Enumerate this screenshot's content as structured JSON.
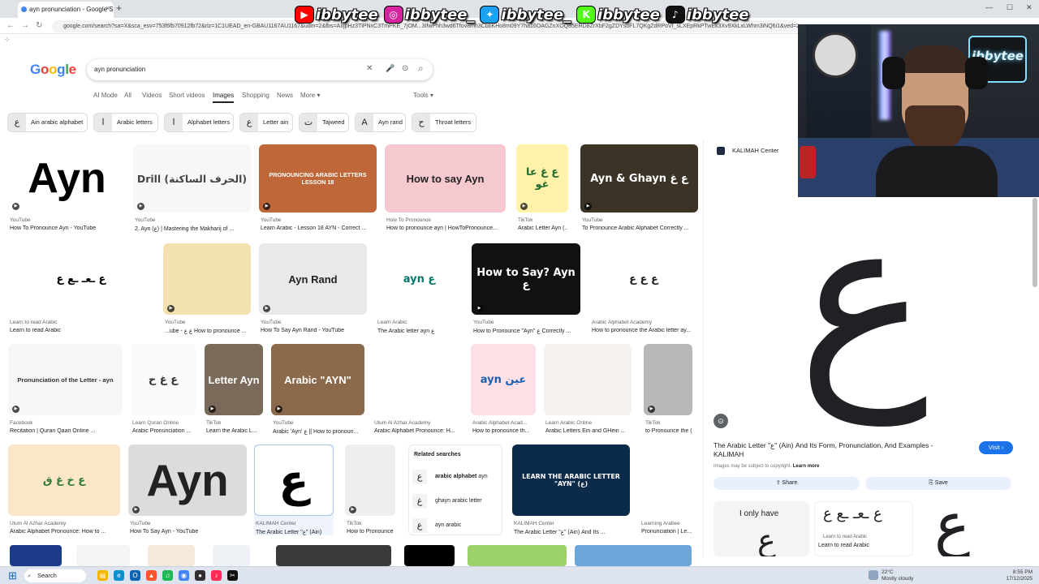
{
  "browser": {
    "tab_title": "ayn pronunciation - Google Search",
    "url": "google.com/search?sa=X&sca_esv=753f6fb70912fb72&rlz=1C1UEAD_en-GBAU1167AU1167&udm=2&fbs=AIIjpHz3TlPNxC3TmPKE_7jOM...3IfwPhh3wd6Tfov8mn3CbbKHo8m09Y7ha16OAGZnXOQ85ERD8ZrXbF2gZDYsoFL7QKgZdRPoVf_sLXEpRkPTwEk3Xv9XkLxLWhm3iNQ6i1&ved=2ahUKEwi",
    "close_glyph": "×",
    "new_tab_glyph": "+",
    "back_glyph": "←",
    "forward_glyph": "→",
    "reload_glyph": "↻",
    "apps_glyph": "⁘",
    "minimize_glyph": "—",
    "maximize_glyph": "☐",
    "window_close_glyph": "✕"
  },
  "social_overlay": [
    {
      "icon": "youtube-icon",
      "glyph": "▶",
      "color": "#ff0000",
      "handle": "ibbytee"
    },
    {
      "icon": "instagram-icon",
      "glyph": "◎",
      "color": "#d6249f",
      "handle": "ibbytee_"
    },
    {
      "icon": "twitter-icon",
      "glyph": "✦",
      "color": "#1da1f2",
      "handle": "ibbytee_"
    },
    {
      "icon": "kick-icon",
      "glyph": "K",
      "color": "#53fc18",
      "handle": "ibbytee"
    },
    {
      "icon": "tiktok-icon",
      "glyph": "♪",
      "color": "#111111",
      "handle": "ibbytee"
    }
  ],
  "google": {
    "logo": "Google",
    "logo_colors": [
      "#4285f4",
      "#ea4335",
      "#fbbc05",
      "#4285f4",
      "#34a853",
      "#ea4335"
    ],
    "query": "ayn pronunciation",
    "clear_glyph": "✕",
    "mic_glyph": "🎤",
    "lens_glyph": "⊙",
    "search_glyph": "⌕",
    "tabs": [
      "AI Mode",
      "All",
      "Videos",
      "Short videos",
      "Images",
      "Shopping",
      "News",
      "More ▾",
      "Tools ▾"
    ],
    "active_tab": "Images"
  },
  "chips": [
    {
      "label": "Ain arabic alphabet",
      "thumb": "ع"
    },
    {
      "label": "Arabic letters",
      "thumb": "ا"
    },
    {
      "label": "Alphabet letters",
      "thumb": "ا"
    },
    {
      "label": "Letter ain",
      "thumb": "ع"
    },
    {
      "label": "Tajweed",
      "thumb": "ت"
    },
    {
      "label": "Ayn rand",
      "thumb": "A"
    },
    {
      "label": "Throat letters",
      "thumb": "ح"
    }
  ],
  "results": [
    {
      "source": "YouTube",
      "title": "How To Pronounce Ayn - YouTube",
      "img_text": "Ayn",
      "bg": "#ffffff",
      "fg": "#000000"
    },
    {
      "source": "YouTube",
      "title": "2. Ayn (ع) | Mastering the Makharij of ...",
      "img_text": "Drill (الحرف الساكنة)",
      "bg": "#f7f7f7",
      "fg": "#444444"
    },
    {
      "source": "YouTube",
      "title": "Learn Arabic - Lesson 18 AYN - Correct ...",
      "img_text": "PRONOUNCING ARABIC LETTERS LESSON 18",
      "bg": "#c0673a",
      "fg": "#ffffff"
    },
    {
      "source": "How To Pronounce",
      "title": "How to pronounce ayn | HowToPronounce...",
      "img_text": "How to say Ayn",
      "bg": "#f5c9cf",
      "fg": "#222222"
    },
    {
      "source": "TikTok",
      "title": "Arabic Letter Ayn (...",
      "img_text": "ع غ عا غو",
      "bg": "#fff1a8",
      "fg": "#1e6b2f"
    },
    {
      "source": "YouTube",
      "title": "To Pronounce Arabic Alphabet Correctly ...",
      "img_text": "Ayn & Ghayn ع غ",
      "bg": "#3a3326",
      "fg": "#ffffff"
    },
    {
      "source": "Learn to read Arabic",
      "title": "Learn to read Arabic",
      "img_text": "ع ـعـ ـع ع",
      "bg": "#ffffff",
      "fg": "#000000"
    },
    {
      "source": "YouTube",
      "title": "...ube - ع ع How to pronounce ...",
      "img_text": "",
      "bg": "#f3e2b0",
      "fg": "#333333"
    },
    {
      "source": "YouTube",
      "title": "How To Say Ayn Rand - YouTube",
      "img_text": "Ayn Rand",
      "bg": "#e9e9e9",
      "fg": "#222222"
    },
    {
      "source": "Learn Arabic",
      "title": "The Arabic letter ayn ع",
      "img_text": "ayn ع",
      "bg": "#ffffff",
      "fg": "#00796b"
    },
    {
      "source": "YouTube",
      "title": "How to Pronounce \"Ayn\" ع Correctly ...",
      "img_text": "How to Say? Ayn ع",
      "bg": "#111111",
      "fg": "#ffffff"
    },
    {
      "source": "Arabic Alphabet Academy",
      "title": "How to pronounce the Arabic letter ay...",
      "img_text": "ع ع ع",
      "bg": "#ffffff",
      "fg": "#222222"
    },
    {
      "source": "Facebook",
      "title": "Recitation | Quran Qaari Online ...",
      "img_text": "Pronunciation of the Letter - ayn",
      "bg": "#f6f6f6",
      "fg": "#333333"
    },
    {
      "source": "Learn Quran Online",
      "title": "Arabic Pronunciation ...",
      "img_text": "ع غ ح",
      "bg": "#fafafa",
      "fg": "#333333"
    },
    {
      "source": "TikTok",
      "title": "Learn the Arabic L...",
      "img_text": "Letter Ayn",
      "bg": "#7a6a5a",
      "fg": "#ffffff"
    },
    {
      "source": "YouTube",
      "title": "Arabic 'Ayn' ع || How to pronoun...",
      "img_text": "Arabic \"AYN\"",
      "bg": "#8a6a4a",
      "fg": "#ffffff"
    },
    {
      "source": "Ulum Al Azhar Academy",
      "title": "Arabic Alphabet Pronounce: H...",
      "img_text": "",
      "bg": "#ffffff",
      "fg": "#333333"
    },
    {
      "source": "Arabic Alphabet Acad...",
      "title": "How to pronounce th...",
      "img_text": "ayn عين",
      "bg": "#fde0e6",
      "fg": "#1a5fb4"
    },
    {
      "source": "Learn Arabic Online",
      "title": "Arabic Letters Ein and GHein ...",
      "img_text": "",
      "bg": "#f7f2ee",
      "fg": "#333333"
    },
    {
      "source": "TikTok",
      "title": "to Pronounce the (...",
      "img_text": "",
      "bg": "#b8b8b8",
      "fg": "#222222"
    },
    {
      "source": "Ulum Al Azhar Academy",
      "title": "Arabic Alphabet Pronounce: How to ...",
      "img_text": "ع خ غ ق",
      "bg": "#fbe7c7",
      "fg": "#2e7d32"
    },
    {
      "source": "YouTube",
      "title": "How To Say Ayn - YouTube",
      "img_text": "Ayn",
      "bg": "#dcdcdc",
      "fg": "#222222"
    },
    {
      "source": "KALIMAH Center",
      "title": "The Arabic Letter \"ع\" (Ain)",
      "img_text": "ع",
      "bg": "#ffffff",
      "fg": "#000000"
    },
    {
      "source": "TikTok",
      "title": "How to Pronounce ...",
      "img_text": "",
      "bg": "#eeeeee",
      "fg": "#222222"
    },
    {
      "source": "KALIMAH Center",
      "title": "The Arabic Letter \"ع\" (Ain) And Its ...",
      "img_text": "LEARN THE ARABIC LETTER \"AYN\" (ع)",
      "bg": "#0c2a4a",
      "fg": "#ffffff"
    },
    {
      "source": "Learning Arabee",
      "title": "Pronunciation | Le...",
      "img_text": "",
      "bg": "#ffffff",
      "fg": "#444444"
    }
  ],
  "related": {
    "heading": "Related searches",
    "items": [
      {
        "text_bold": "arabic alphabet",
        "text_rest": " ayn",
        "thumb": "ع"
      },
      {
        "text_bold": "",
        "text_rest": "ghayn arabic letter",
        "thumb": "غ"
      },
      {
        "text_bold": "",
        "text_rest": "ayn arabic",
        "thumb": "ع"
      }
    ]
  },
  "preview": {
    "source": "KALIMAH Center",
    "big_letter": "ع",
    "lens_glyph": "⊙",
    "title": "The Arabic Letter \"ع\" (Ain) And Its Form, Pronunciation, And Examples - KALIMAH",
    "visit_label": "Visit ›",
    "copyright": "Images may be subject to copyright.",
    "learn_more": "Learn more",
    "share_label": "⇪ Share",
    "save_label": "⎘ Save",
    "thumbs": [
      {
        "text": "I only have",
        "letter": "ع"
      },
      {
        "text": "ع ـعـ ـع ع",
        "caption": "Learn to read Arabic",
        "caption2": "Learn to read Arabic"
      },
      {
        "text": "ع"
      }
    ]
  },
  "webcam": {
    "sign": "ibbytee"
  },
  "taskbar": {
    "start_glyph": "⊞",
    "search_label": "Search",
    "weather_temp": "22°C",
    "weather_text": "Mostly cloudy",
    "time": "8:55 PM",
    "date": "17/12/2025",
    "apps": [
      {
        "name": "file-explorer-icon",
        "color": "#f4b400",
        "glyph": "▤"
      },
      {
        "name": "edge-icon",
        "color": "#0c8fd1",
        "glyph": "e"
      },
      {
        "name": "outlook-icon",
        "color": "#0a64b4",
        "glyph": "O"
      },
      {
        "name": "brave-icon",
        "color": "#fb542b",
        "glyph": "▲"
      },
      {
        "name": "spotify-icon",
        "color": "#1db954",
        "glyph": "♫"
      },
      {
        "name": "chrome-icon",
        "color": "#4285f4",
        "glyph": "◉"
      },
      {
        "name": "obs-icon",
        "color": "#302e31",
        "glyph": "●"
      },
      {
        "name": "tiktok-live-icon",
        "color": "#fe2c55",
        "glyph": "♪"
      },
      {
        "name": "capcut-icon",
        "color": "#111111",
        "glyph": "✂"
      }
    ]
  }
}
